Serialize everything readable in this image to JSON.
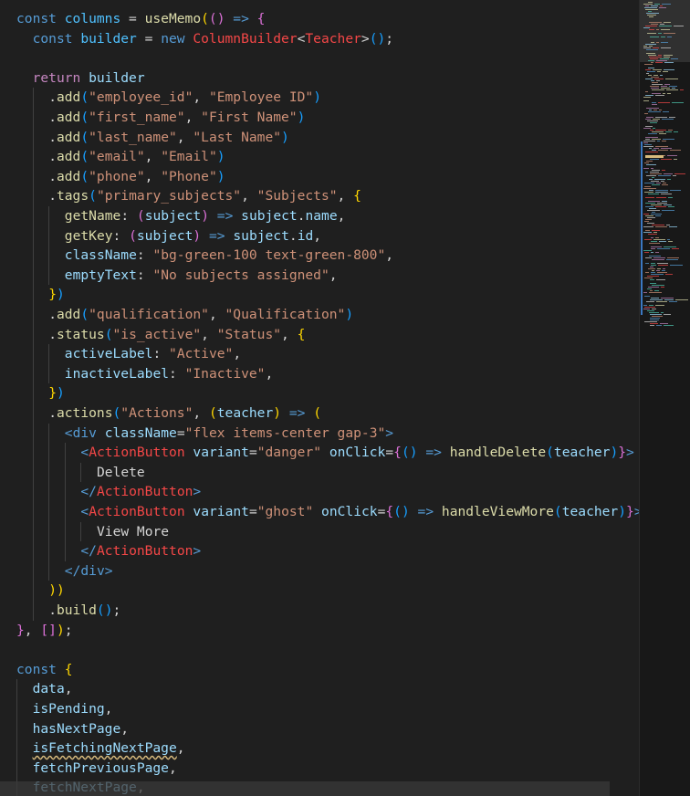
{
  "editor": {
    "language": "tsx",
    "theme": {
      "background": "#1f1f1f",
      "keyword": "#569cd6",
      "control": "#c586c0",
      "function": "#dcdcaa",
      "variable": "#9cdcfe",
      "string": "#ce9178",
      "jsx_tag": "#f44747",
      "bracket_1": "#ffd700",
      "bracket_2": "#da70d6",
      "bracket_3": "#179fff"
    },
    "squiggle_on": "isFetchingNextPage",
    "lines": [
      [
        [
          "kw",
          "const"
        ],
        [
          "p",
          " "
        ],
        [
          "const",
          "columns"
        ],
        [
          "p",
          " = "
        ],
        [
          "fn",
          "useMemo"
        ],
        [
          "b1",
          "("
        ],
        [
          "b2",
          "()"
        ],
        [
          "p",
          " "
        ],
        [
          "kw",
          "=>"
        ],
        [
          "p",
          " "
        ],
        [
          "b2",
          "{"
        ]
      ],
      [
        [
          "kw",
          "const"
        ],
        [
          "p",
          " "
        ],
        [
          "const",
          "builder"
        ],
        [
          "p",
          " = "
        ],
        [
          "kw",
          "new"
        ],
        [
          "p",
          " "
        ],
        [
          "err",
          "ColumnBuilder"
        ],
        [
          "p",
          "<"
        ],
        [
          "err",
          "Teacher"
        ],
        [
          "p",
          ">"
        ],
        [
          "b3",
          "()"
        ],
        [
          "p",
          ";"
        ]
      ],
      [],
      [
        [
          "ret",
          "return"
        ],
        [
          "p",
          " "
        ],
        [
          "var",
          "builder"
        ]
      ],
      [
        [
          "p",
          "."
        ],
        [
          "fn",
          "add"
        ],
        [
          "b3",
          "("
        ],
        [
          "str",
          "\"employee_id\""
        ],
        [
          "p",
          ", "
        ],
        [
          "str",
          "\"Employee ID\""
        ],
        [
          "b3",
          ")"
        ]
      ],
      [
        [
          "p",
          "."
        ],
        [
          "fn",
          "add"
        ],
        [
          "b3",
          "("
        ],
        [
          "str",
          "\"first_name\""
        ],
        [
          "p",
          ", "
        ],
        [
          "str",
          "\"First Name\""
        ],
        [
          "b3",
          ")"
        ]
      ],
      [
        [
          "p",
          "."
        ],
        [
          "fn",
          "add"
        ],
        [
          "b3",
          "("
        ],
        [
          "str",
          "\"last_name\""
        ],
        [
          "p",
          ", "
        ],
        [
          "str",
          "\"Last Name\""
        ],
        [
          "b3",
          ")"
        ]
      ],
      [
        [
          "p",
          "."
        ],
        [
          "fn",
          "add"
        ],
        [
          "b3",
          "("
        ],
        [
          "str",
          "\"email\""
        ],
        [
          "p",
          ", "
        ],
        [
          "str",
          "\"Email\""
        ],
        [
          "b3",
          ")"
        ]
      ],
      [
        [
          "p",
          "."
        ],
        [
          "fn",
          "add"
        ],
        [
          "b3",
          "("
        ],
        [
          "str",
          "\"phone\""
        ],
        [
          "p",
          ", "
        ],
        [
          "str",
          "\"Phone\""
        ],
        [
          "b3",
          ")"
        ]
      ],
      [
        [
          "p",
          "."
        ],
        [
          "fn",
          "tags"
        ],
        [
          "b3",
          "("
        ],
        [
          "str",
          "\"primary_subjects\""
        ],
        [
          "p",
          ", "
        ],
        [
          "str",
          "\"Subjects\""
        ],
        [
          "p",
          ", "
        ],
        [
          "b1",
          "{"
        ]
      ],
      [
        [
          "fn",
          "getName"
        ],
        [
          "p",
          ": "
        ],
        [
          "b2",
          "("
        ],
        [
          "var",
          "subject"
        ],
        [
          "b2",
          ")"
        ],
        [
          "p",
          " "
        ],
        [
          "kw",
          "=>"
        ],
        [
          "p",
          " "
        ],
        [
          "var",
          "subject"
        ],
        [
          "p",
          "."
        ],
        [
          "var",
          "name"
        ],
        [
          "p",
          ","
        ]
      ],
      [
        [
          "fn",
          "getKey"
        ],
        [
          "p",
          ": "
        ],
        [
          "b2",
          "("
        ],
        [
          "var",
          "subject"
        ],
        [
          "b2",
          ")"
        ],
        [
          "p",
          " "
        ],
        [
          "kw",
          "=>"
        ],
        [
          "p",
          " "
        ],
        [
          "var",
          "subject"
        ],
        [
          "p",
          "."
        ],
        [
          "var",
          "id"
        ],
        [
          "p",
          ","
        ]
      ],
      [
        [
          "prop",
          "className"
        ],
        [
          "p",
          ": "
        ],
        [
          "str",
          "\"bg-green-100 text-green-800\""
        ],
        [
          "p",
          ","
        ]
      ],
      [
        [
          "prop",
          "emptyText"
        ],
        [
          "p",
          ": "
        ],
        [
          "str",
          "\"No subjects assigned\""
        ],
        [
          "p",
          ","
        ]
      ],
      [
        [
          "b1",
          "}"
        ],
        [
          "b3",
          ")"
        ]
      ],
      [
        [
          "p",
          "."
        ],
        [
          "fn",
          "add"
        ],
        [
          "b3",
          "("
        ],
        [
          "str",
          "\"qualification\""
        ],
        [
          "p",
          ", "
        ],
        [
          "str",
          "\"Qualification\""
        ],
        [
          "b3",
          ")"
        ]
      ],
      [
        [
          "p",
          "."
        ],
        [
          "fn",
          "status"
        ],
        [
          "b3",
          "("
        ],
        [
          "str",
          "\"is_active\""
        ],
        [
          "p",
          ", "
        ],
        [
          "str",
          "\"Status\""
        ],
        [
          "p",
          ", "
        ],
        [
          "b1",
          "{"
        ]
      ],
      [
        [
          "prop",
          "activeLabel"
        ],
        [
          "p",
          ": "
        ],
        [
          "str",
          "\"Active\""
        ],
        [
          "p",
          ","
        ]
      ],
      [
        [
          "prop",
          "inactiveLabel"
        ],
        [
          "p",
          ": "
        ],
        [
          "str",
          "\"Inactive\""
        ],
        [
          "p",
          ","
        ]
      ],
      [
        [
          "b1",
          "}"
        ],
        [
          "b3",
          ")"
        ]
      ],
      [
        [
          "p",
          "."
        ],
        [
          "fn",
          "actions"
        ],
        [
          "b3",
          "("
        ],
        [
          "str",
          "\"Actions\""
        ],
        [
          "p",
          ", "
        ],
        [
          "b1",
          "("
        ],
        [
          "var",
          "teacher"
        ],
        [
          "b1",
          ")"
        ],
        [
          "p",
          " "
        ],
        [
          "kw",
          "=>"
        ],
        [
          "p",
          " "
        ],
        [
          "b1",
          "("
        ]
      ],
      [
        [
          "tag",
          "<"
        ],
        [
          "tag",
          "div"
        ],
        [
          "p",
          " "
        ],
        [
          "attr",
          "className"
        ],
        [
          "p",
          "="
        ],
        [
          "str",
          "\"flex items-center gap-3\""
        ],
        [
          "tag",
          ">"
        ]
      ],
      [
        [
          "tag",
          "<"
        ],
        [
          "err",
          "ActionButton"
        ],
        [
          "p",
          " "
        ],
        [
          "attr",
          "variant"
        ],
        [
          "p",
          "="
        ],
        [
          "str",
          "\"danger\""
        ],
        [
          "p",
          " "
        ],
        [
          "attr",
          "onClick"
        ],
        [
          "p",
          "="
        ],
        [
          "b2",
          "{"
        ],
        [
          "b3",
          "()"
        ],
        [
          "p",
          " "
        ],
        [
          "kw",
          "=>"
        ],
        [
          "p",
          " "
        ],
        [
          "fn",
          "handleDelete"
        ],
        [
          "b3",
          "("
        ],
        [
          "var",
          "teacher"
        ],
        [
          "b3",
          ")"
        ],
        [
          "b2",
          "}"
        ],
        [
          "tag",
          ">"
        ]
      ],
      [
        [
          "text",
          "Delete"
        ]
      ],
      [
        [
          "tag",
          "</"
        ],
        [
          "err",
          "ActionButton"
        ],
        [
          "tag",
          ">"
        ]
      ],
      [
        [
          "tag",
          "<"
        ],
        [
          "err",
          "ActionButton"
        ],
        [
          "p",
          " "
        ],
        [
          "attr",
          "variant"
        ],
        [
          "p",
          "="
        ],
        [
          "str",
          "\"ghost\""
        ],
        [
          "p",
          " "
        ],
        [
          "attr",
          "onClick"
        ],
        [
          "p",
          "="
        ],
        [
          "b2",
          "{"
        ],
        [
          "b3",
          "()"
        ],
        [
          "p",
          " "
        ],
        [
          "kw",
          "=>"
        ],
        [
          "p",
          " "
        ],
        [
          "fn",
          "handleViewMore"
        ],
        [
          "b3",
          "("
        ],
        [
          "var",
          "teacher"
        ],
        [
          "b3",
          ")"
        ],
        [
          "b2",
          "}"
        ],
        [
          "tag",
          ">"
        ]
      ],
      [
        [
          "text",
          "View More"
        ]
      ],
      [
        [
          "tag",
          "</"
        ],
        [
          "err",
          "ActionButton"
        ],
        [
          "tag",
          ">"
        ]
      ],
      [
        [
          "tag",
          "</"
        ],
        [
          "tag",
          "div"
        ],
        [
          "tag",
          ">"
        ]
      ],
      [
        [
          "b1",
          "))"
        ]
      ],
      [
        [
          "p",
          "."
        ],
        [
          "fn",
          "build"
        ],
        [
          "b3",
          "()"
        ],
        [
          "p",
          ";"
        ]
      ],
      [
        [
          "b2",
          "}"
        ],
        [
          "p",
          ", "
        ],
        [
          "b2",
          "[]"
        ],
        [
          "b1",
          ")"
        ],
        [
          "p",
          ";"
        ]
      ],
      [],
      [
        [
          "kw",
          "const"
        ],
        [
          "p",
          " "
        ],
        [
          "b1",
          "{"
        ]
      ],
      [
        [
          "var",
          "data"
        ],
        [
          "p",
          ","
        ]
      ],
      [
        [
          "var",
          "isPending"
        ],
        [
          "p",
          ","
        ]
      ],
      [
        [
          "var",
          "hasNextPage"
        ],
        [
          "p",
          ","
        ]
      ],
      [
        [
          "var",
          "isFetchingNextPage"
        ],
        [
          "p",
          ","
        ]
      ],
      [
        [
          "var",
          "fetchPreviousPage"
        ],
        [
          "p",
          ","
        ]
      ],
      [
        [
          "var",
          "fetchNextPage"
        ],
        [
          "p",
          ","
        ]
      ]
    ]
  }
}
